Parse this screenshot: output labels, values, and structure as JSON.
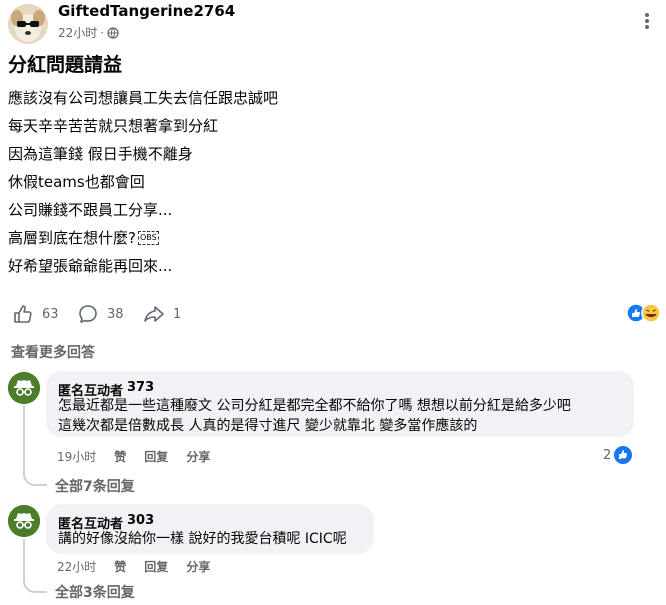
{
  "post": {
    "author": "GiftedTangerine2764",
    "time": "22小时",
    "separator": "·",
    "title": "分紅問題請益",
    "lines": [
      "應該沒有公司想讓員工失去信任跟忠誠吧",
      "每天辛辛苦苦就只想著拿到分紅",
      "因為這筆錢 假日手機不離身",
      "休假teams也都會回",
      "公司賺錢不跟員工分享...",
      "高層到底在想什麼? ",
      "好希望張爺爺能再回來..."
    ],
    "obs_emoji": "OBS"
  },
  "actions": {
    "likes": "63",
    "comments": "38",
    "shares": "1"
  },
  "see_more": "查看更多回答",
  "comments": [
    {
      "author": "匿名互动者",
      "count": "373",
      "text_lines": [
        "怎最近都是一些這種廢文 公司分紅是都完全都不給你了嗎 想想以前分紅是給多少吧",
        "這幾次都是倍數成長 人真的是得寸進尺 變少就靠北 變多當作應該的"
      ],
      "time": "19小时",
      "like": "赞",
      "reply": "回复",
      "share": "分享",
      "reactions": "2",
      "all_replies": "全部7条回复"
    },
    {
      "author": "匿名互动者",
      "count": "303",
      "text_lines": [
        "講的好像沒給你一樣 說好的我愛台積呢 ICIC呢"
      ],
      "time": "22小时",
      "like": "赞",
      "reply": "回复",
      "share": "分享",
      "all_replies": "全部3条回复"
    }
  ],
  "colors": {
    "accent": "#1877f2",
    "muted": "#65676b",
    "bubble": "#f0f2f5",
    "anon_avatar": "#4b7d2a"
  }
}
